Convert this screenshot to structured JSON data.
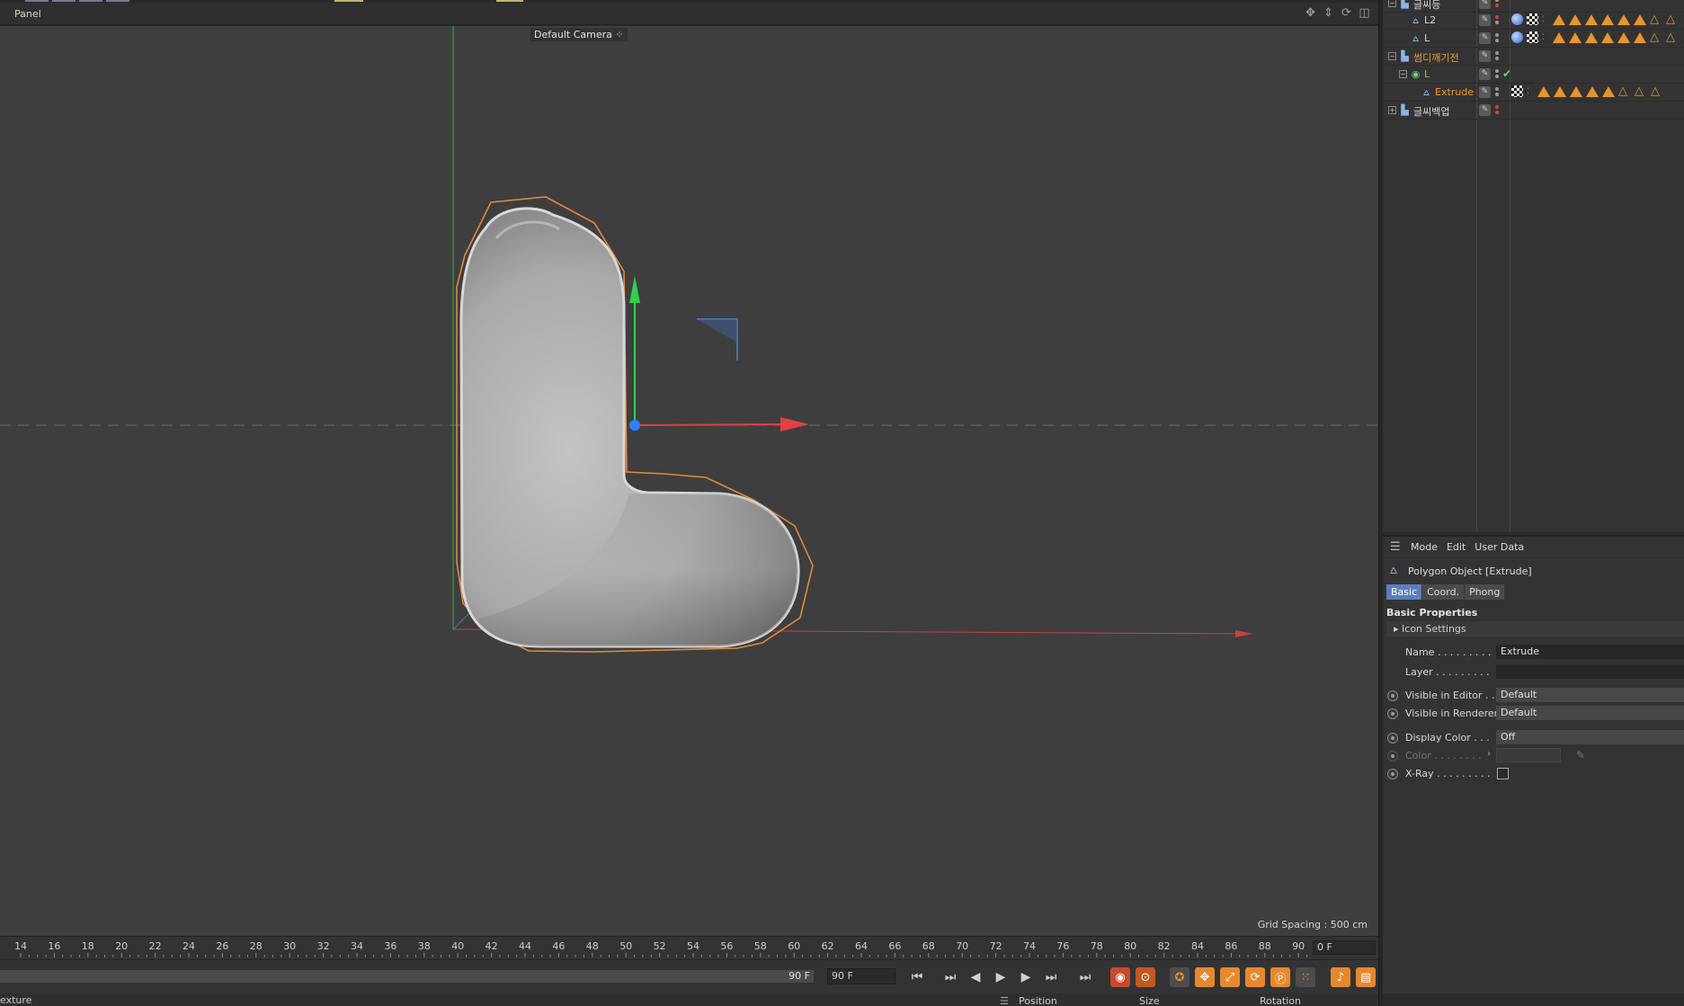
{
  "viewport": {
    "panel_menu": "Panel",
    "camera": "Default Camera",
    "grid_spacing": "Grid Spacing : 500 cm"
  },
  "timeline": {
    "ticks": [
      "14",
      "16",
      "18",
      "20",
      "22",
      "24",
      "26",
      "28",
      "30",
      "32",
      "34",
      "36",
      "38",
      "40",
      "42",
      "44",
      "46",
      "48",
      "50",
      "52",
      "54",
      "56",
      "58",
      "60",
      "62",
      "64",
      "66",
      "68",
      "70",
      "72",
      "74",
      "76",
      "78",
      "80",
      "82",
      "84",
      "86",
      "88",
      "90"
    ],
    "current_frame": "0 F",
    "scrub_end": "90 F",
    "end_frame": "90 F"
  },
  "statusbar": {
    "text": "exture",
    "headers": [
      "Position",
      "Size",
      "Rotation"
    ]
  },
  "objects": [
    {
      "name": "글씨등",
      "icon": "null-icon",
      "indent": 0,
      "color": "normal"
    },
    {
      "name": "L2",
      "icon": "polygon-icon",
      "indent": 1,
      "color": "normal"
    },
    {
      "name": "L",
      "icon": "polygon-icon",
      "indent": 1,
      "color": "normal"
    },
    {
      "name": "썸디깨기전",
      "icon": "null-icon",
      "indent": 0,
      "color": "orange"
    },
    {
      "name": "L",
      "icon": "generator-icon",
      "indent": 1,
      "color": "orange"
    },
    {
      "name": "Extrude",
      "icon": "polygon-icon",
      "indent": 2,
      "color": "orange"
    },
    {
      "name": "글씨백업",
      "icon": "null-icon",
      "indent": 0,
      "color": "normal"
    }
  ],
  "attributes": {
    "menu": [
      "Mode",
      "Edit",
      "User Data"
    ],
    "object_title": "Polygon Object [Extrude]",
    "tabs": [
      "Basic",
      "Coord.",
      "Phong"
    ],
    "section": "Basic Properties",
    "icon_settings": "Icon Settings",
    "name_label": "Name . . . . . . . . .",
    "name_value": "Extrude",
    "layer_label": "Layer . . . . . . . . .",
    "visible_editor_label": "Visible in Editor . .",
    "visible_editor_value": "Default",
    "visible_renderer_label": "Visible in Renderer",
    "visible_renderer_value": "Default",
    "display_color_label": "Display Color . . .",
    "display_color_value": "Off",
    "color_label": "Color . . . . . . . .",
    "xray_label": "X-Ray . . . . . . . . ."
  },
  "colors": {
    "accent_orange": "#f09a2b",
    "tab_active": "#5b7fbd",
    "axis_x": "#e04040",
    "axis_y": "#30d050",
    "viewport_bg": "#3e3e3e"
  }
}
